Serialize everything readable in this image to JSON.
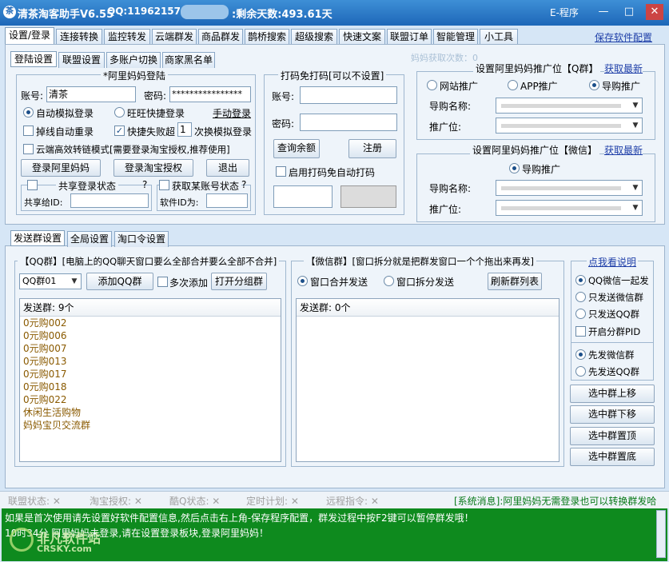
{
  "window": {
    "app_name": "清茶淘客助手V6.55",
    "qq": "QQ:11962157",
    "days_left": ":剩余天数:493.61天",
    "e_program": "E-程序",
    "min": "—",
    "max": "□",
    "close": "✕"
  },
  "main_tabs": [
    "设置/登录",
    "连接转换",
    "监控转发",
    "云端群发",
    "商品群发",
    "鹊桥搜索",
    "超级搜索",
    "快速文案",
    "联盟订单",
    "智能管理",
    "小工具"
  ],
  "save_config": "保存软件配置",
  "mama_count": "妈妈获取次数：0",
  "sub_tabs": [
    "登陆设置",
    "联盟设置",
    "多账户切换",
    "商家黑名单"
  ],
  "login": {
    "title": "*阿里妈妈登陆",
    "account_label": "账号:",
    "account_value": "清茶",
    "password_label": "密码:",
    "password_value": "****************",
    "auto_sim": "自动模拟登录",
    "wangwang": "旺旺快捷登录",
    "manual": "手动登录",
    "reconnect": "掉线自动重录",
    "quick_fail": "快捷失败超",
    "fail_count": "1",
    "switch_sim": "次换模拟登录",
    "cloud_mode": "云端高效转链模式[需要登录淘宝授权,推荐使用]",
    "btn_login_mama": "登录阿里妈妈",
    "btn_login_taobao": "登录淘宝授权",
    "btn_exit": "退出",
    "share_title": "共享登录状态",
    "share_q": "?",
    "share_to": "共享给ID:",
    "get_title": "获取某账号状态",
    "get_q": "?",
    "soft_id": "软件ID为:"
  },
  "captcha": {
    "title": "打码免打码[可以不设置]",
    "account_label": "账号:",
    "password_label": "密码:",
    "btn_query": "查询余额",
    "btn_register": "注册",
    "enable": "启用打码免自动打码"
  },
  "promo_q": {
    "title": "设置阿里妈妈推广位【Q群】",
    "fetch": "获取最新",
    "site": "网站推广",
    "app": "APP推广",
    "guide": "导购推广",
    "guide_name": "导购名称:",
    "position": "推广位:"
  },
  "promo_wx": {
    "title": "设置阿里妈妈推广位【微信】",
    "fetch": "获取最新",
    "guide": "导购推广",
    "guide_name": "导购名称:",
    "position": "推广位:"
  },
  "send_tabs": [
    "发送群设置",
    "全局设置",
    "淘口令设置"
  ],
  "qq_group": {
    "title": "【QQ群】[电脑上的QQ聊天窗口要么全部合并要么全部不合并]",
    "select": "QQ群01",
    "btn_add": "添加QQ群",
    "multi_add": "多次添加",
    "btn_open": "打开分组群",
    "header": "发送群: 9个",
    "items": [
      "0元购002",
      "0元购006",
      "0元购007",
      "0元购013",
      "0元购017",
      "0元购018",
      "0元购022",
      "休闲生活购物",
      "妈妈宝贝交流群"
    ]
  },
  "wx_group": {
    "title": "【微信群】[窗口拆分就是把群发窗口一个个拖出来再发]",
    "merge": "窗口合并发送",
    "split": "窗口拆分发送",
    "btn_refresh": "刷新群列表",
    "header": "发送群: 0个"
  },
  "options": {
    "help": "点我看说明",
    "qq_wx": "QQ微信一起发",
    "only_wx": "只发送微信群",
    "only_qq": "只发送QQ群",
    "group_pid": "开启分群PID",
    "wx_first": "先发微信群",
    "qq_first": "先发送QQ群",
    "btn_up": "选中群上移",
    "btn_down": "选中群下移",
    "btn_top": "选中群置顶",
    "btn_bottom": "选中群置底"
  },
  "status": {
    "union": "联盟状态: ✕",
    "taobao": "淘宝授权: ✕",
    "kuq": "酷Q状态: ✕",
    "timer": "定时计划: ✕",
    "remote": "远程指令: ✕",
    "message": "[系统消息]:阿里妈妈无需登录也可以转换群发哈"
  },
  "log": {
    "line1": "如果是首次使用请先设置好软件配置信息,然后点击右上角-保存程序配置，群发过程中按F2键可以暂停群发哦！",
    "line2": "10时34分 阿里妈妈未登录,请在设置登录板块,登录阿里妈妈！",
    "watermark_cn": "非凡软件站",
    "watermark_en": "CRSKY.com"
  }
}
